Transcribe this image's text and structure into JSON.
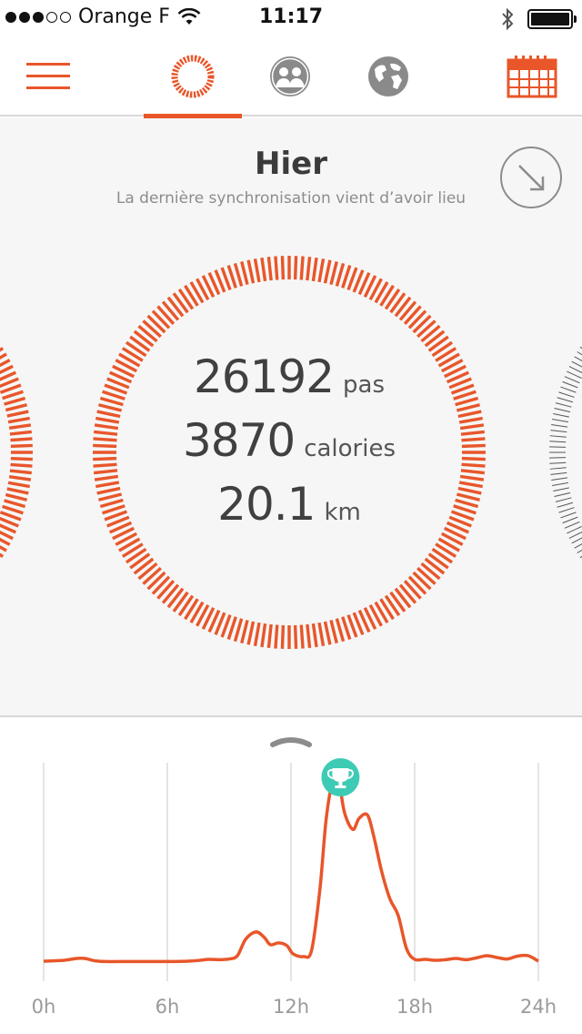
{
  "status_bar": {
    "carrier": "Orange F",
    "time": "11:17",
    "signal_full": 3,
    "signal_total": 5
  },
  "nav": {
    "items": [
      {
        "icon": "hamburger-menu-icon",
        "active": false
      },
      {
        "icon": "activity-ring-icon",
        "active": true
      },
      {
        "icon": "friends-icon",
        "active": false
      },
      {
        "icon": "globe-icon",
        "active": false
      },
      {
        "icon": "calendar-icon",
        "active": false
      }
    ]
  },
  "summary": {
    "title": "Hier",
    "sync_text": "La dernière synchronisation vient d’avoir lieu",
    "stats": [
      {
        "value": "26192",
        "unit": "pas"
      },
      {
        "value": "3870",
        "unit": "calories"
      },
      {
        "value": "20.1",
        "unit": "km"
      }
    ]
  },
  "colors": {
    "accent": "#e8562a",
    "trophy": "#3ecbb5",
    "gridline": "#dcdcdc"
  },
  "chart_data": {
    "type": "line",
    "x_tick_labels": [
      "0h",
      "6h",
      "12h",
      "18h",
      "24h"
    ],
    "xlim": [
      0,
      24
    ],
    "ylim": [
      0,
      100
    ],
    "grid": true,
    "annotations": [
      {
        "type": "trophy-icon",
        "x": 14.4,
        "y": 100
      }
    ],
    "series": [
      {
        "x": [
          0,
          1,
          1.6,
          2,
          2.5,
          3,
          4,
          5,
          6,
          7,
          7.6,
          8,
          8.5,
          9,
          9.4,
          9.8,
          10.3,
          10.7,
          11,
          11.4,
          11.8,
          12.1,
          12.6,
          13,
          13.4,
          13.7,
          14,
          14.3,
          14.6,
          15,
          15.3,
          15.7,
          16,
          16.4,
          16.8,
          17.2,
          17.6,
          18,
          18.5,
          19,
          19.5,
          20,
          20.5,
          21,
          21.5,
          22,
          22.5,
          23,
          23.5,
          24
        ],
        "y": [
          1,
          1.5,
          2.5,
          2.5,
          1.2,
          0.8,
          0.8,
          0.8,
          0.8,
          1,
          1.5,
          2,
          1.8,
          2.2,
          4,
          13,
          17,
          14,
          10,
          11,
          9.5,
          5,
          3.5,
          7,
          40,
          78,
          98,
          100,
          82,
          73,
          79,
          81,
          70,
          50,
          35,
          26,
          8,
          2,
          2,
          1.5,
          1.8,
          2.5,
          1.8,
          2.8,
          4,
          3,
          2.2,
          3.8,
          4,
          1
        ]
      }
    ]
  }
}
